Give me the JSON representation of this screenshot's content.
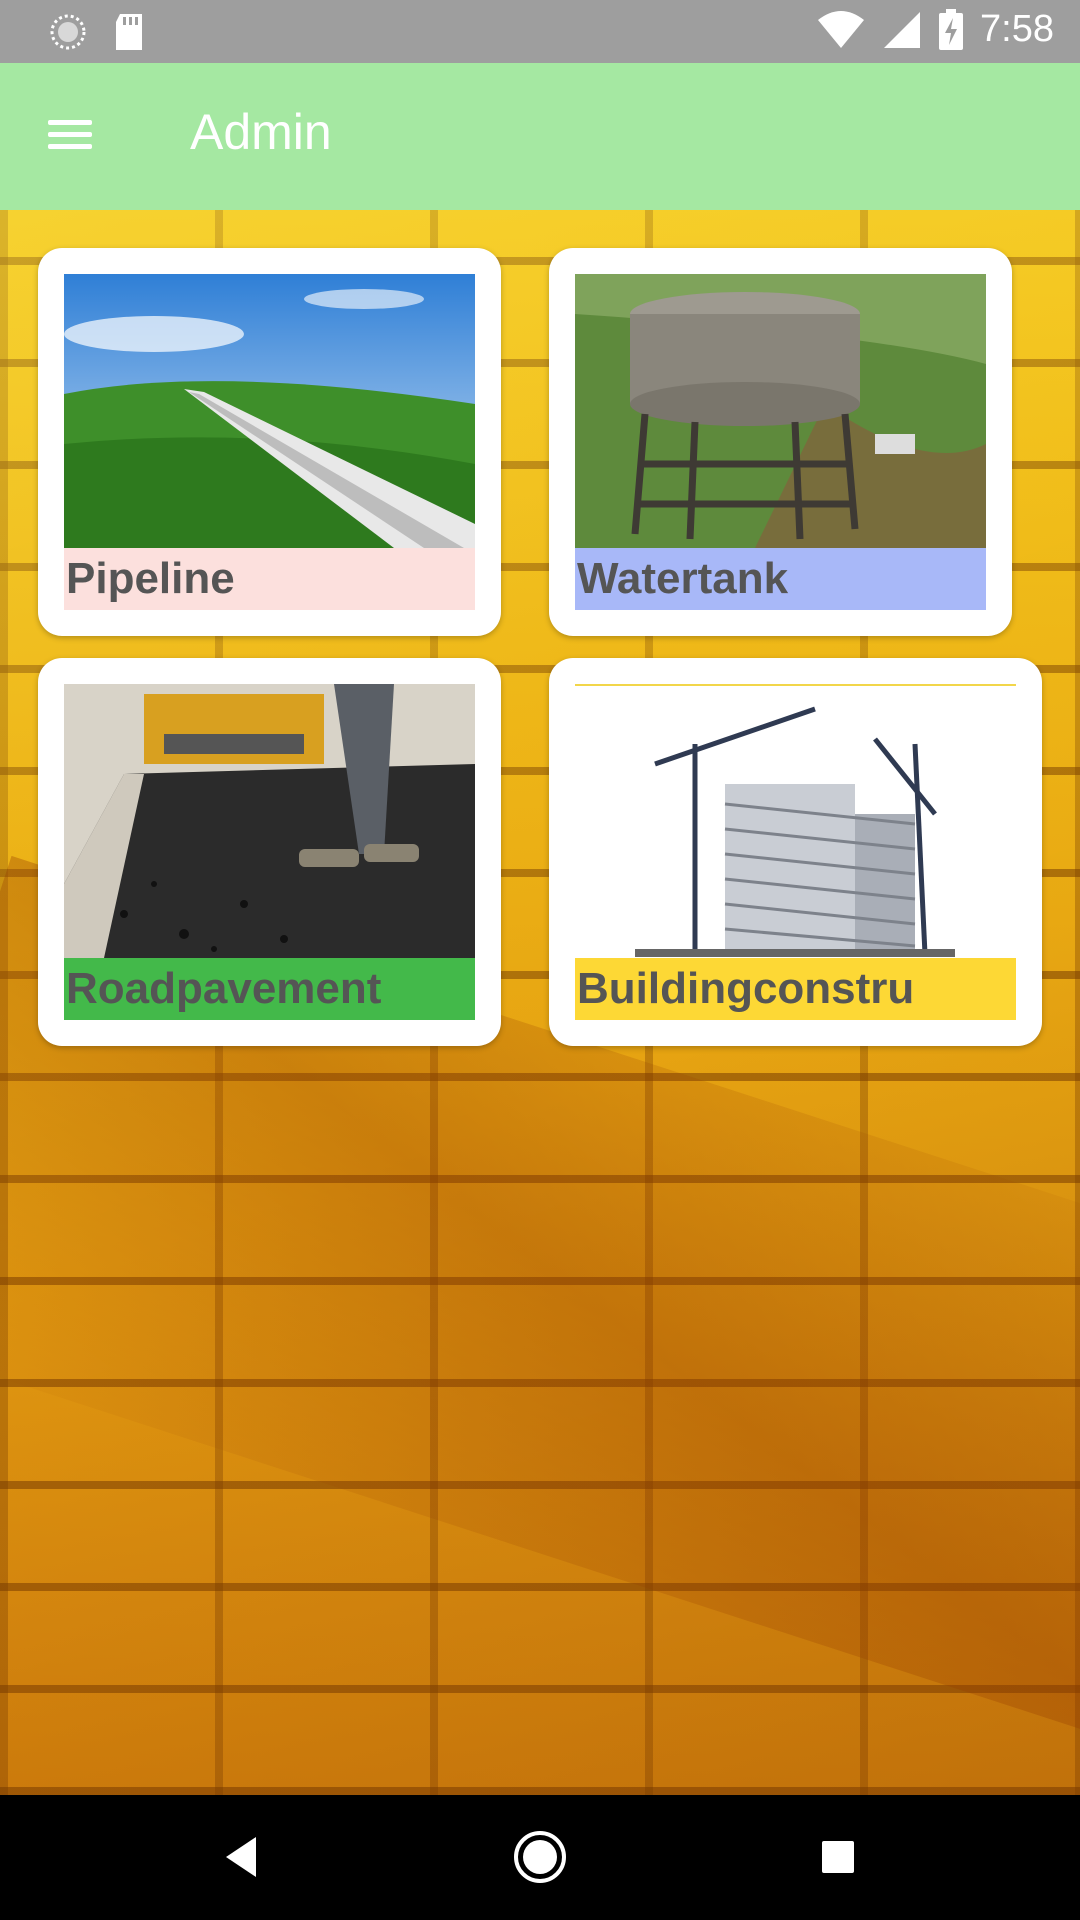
{
  "status_bar": {
    "time": "7:58",
    "left_icons": [
      "loading-icon",
      "sd-card-icon"
    ],
    "right_icons": [
      "wifi-icon",
      "signal-icon",
      "battery-charging-icon"
    ]
  },
  "app_bar": {
    "title": "Admin",
    "menu_icon": "hamburger-menu-icon",
    "color": "#A5E8A2"
  },
  "tiles": [
    {
      "label": "Pipeline",
      "label_bg": "#FCE0DD",
      "image": "pipeline-photo"
    },
    {
      "label": "Watertank",
      "label_bg": "#A8B8F8",
      "image": "watertank-photo"
    },
    {
      "label": "Roadpavement",
      "label_bg": "#43B94A",
      "image": "road-paving-photo"
    },
    {
      "label": "Buildingconstru",
      "label_bg": "#FDD835",
      "image": "building-construction-photo"
    }
  ],
  "nav_bar": {
    "buttons": [
      "back-icon",
      "home-icon",
      "recents-icon"
    ]
  }
}
